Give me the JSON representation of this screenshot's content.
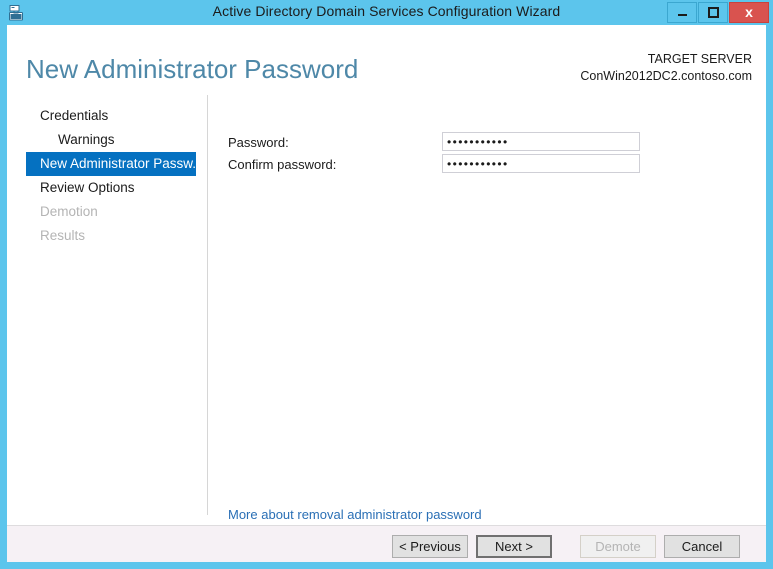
{
  "window": {
    "title": "Active Directory Domain Services Configuration Wizard",
    "icon": "server-manager-toolbox-icon",
    "controls": {
      "minimize": "minimize-icon",
      "maximize": "maximize-icon",
      "close": "x"
    },
    "frame_color": "#5cc5ec",
    "close_color": "#d9534f"
  },
  "header": {
    "page_title": "New Administrator Password",
    "target_label": "TARGET SERVER",
    "target_server": "ConWin2012DC2.contoso.com",
    "title_color": "#4e88a8"
  },
  "nav": {
    "selected_color": "#0571c1",
    "items": [
      {
        "label": "Credentials",
        "state": "normal",
        "indent": false
      },
      {
        "label": "Warnings",
        "state": "normal",
        "indent": true
      },
      {
        "label": "New Administrator Passw...",
        "state": "selected",
        "indent": false
      },
      {
        "label": "Review Options",
        "state": "normal",
        "indent": false
      },
      {
        "label": "Demotion",
        "state": "disabled",
        "indent": false
      },
      {
        "label": "Results",
        "state": "disabled",
        "indent": false
      }
    ]
  },
  "content": {
    "password_label": "Password:",
    "confirm_label": "Confirm password:",
    "password_value": "•••••••••••",
    "confirm_value": "•••••••••••",
    "password_placeholder": "",
    "confirm_placeholder": "",
    "more_link": "More about removal administrator password",
    "link_color": "#2a6fb5"
  },
  "footer": {
    "previous": "< Previous",
    "next": "Next >",
    "demote": "Demote",
    "cancel": "Cancel",
    "background": "#f6f1f5"
  }
}
